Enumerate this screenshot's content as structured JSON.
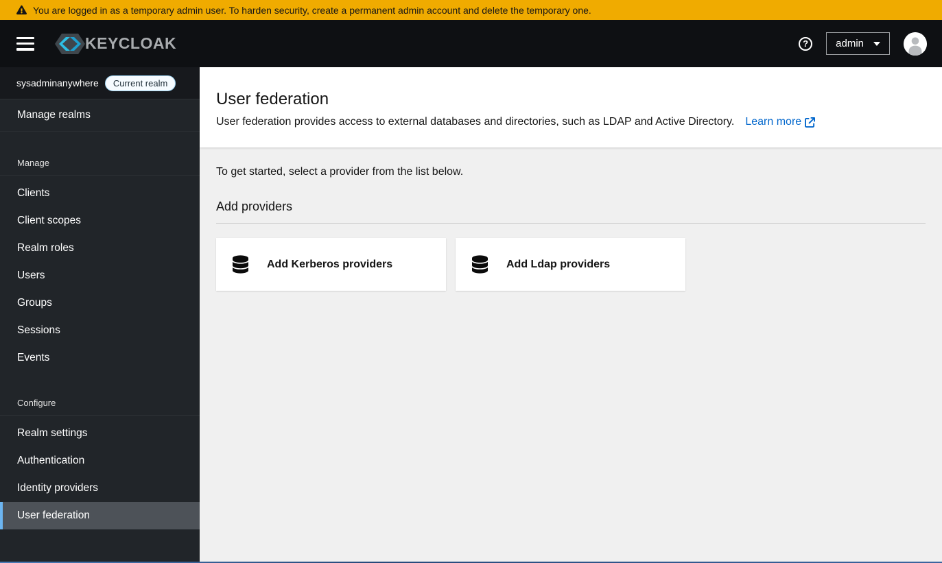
{
  "banner": {
    "message": "You are logged in as a temporary admin user. To harden security, create a permanent admin account and delete the temporary one."
  },
  "masthead": {
    "brand": "KEYCLOAK",
    "username": "admin"
  },
  "sidebar": {
    "realm_name": "sysadminanywhere",
    "realm_badge": "Current realm",
    "manage_realms": "Manage realms",
    "sections": [
      {
        "label": "Manage",
        "items": [
          {
            "label": "Clients"
          },
          {
            "label": "Client scopes"
          },
          {
            "label": "Realm roles"
          },
          {
            "label": "Users"
          },
          {
            "label": "Groups"
          },
          {
            "label": "Sessions"
          },
          {
            "label": "Events"
          }
        ]
      },
      {
        "label": "Configure",
        "items": [
          {
            "label": "Realm settings"
          },
          {
            "label": "Authentication"
          },
          {
            "label": "Identity providers"
          },
          {
            "label": "User federation",
            "selected": true
          }
        ]
      }
    ]
  },
  "page": {
    "title": "User federation",
    "description": "User federation provides access to external databases and directories, such as LDAP and Active Directory.",
    "learn_more_label": "Learn more",
    "intro": "To get started, select a provider from the list below.",
    "section_heading": "Add providers",
    "providers": [
      {
        "label": "Add Kerberos providers"
      },
      {
        "label": "Add Ldap providers"
      }
    ]
  },
  "colors": {
    "banner_bg": "#f0ab00",
    "masthead_bg": "#0e1013",
    "sidebar_bg": "#212529",
    "selected_item_bg": "#4d5258",
    "selected_border": "#6cb5f1",
    "link_blue": "#0066cc",
    "content_bg": "#f0f0f0"
  }
}
